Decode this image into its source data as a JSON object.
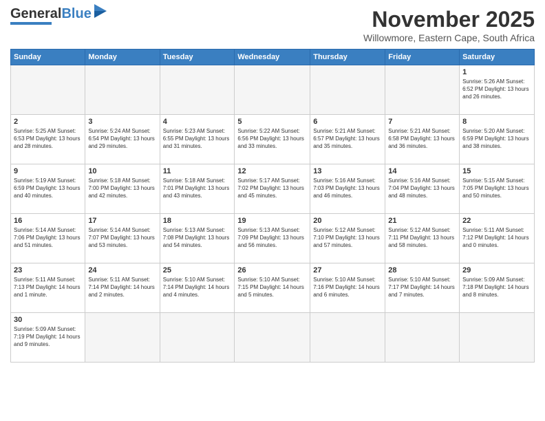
{
  "header": {
    "logo": {
      "text_general": "General",
      "text_blue": "Blue"
    },
    "title": "November 2025",
    "subtitle": "Willowmore, Eastern Cape, South Africa"
  },
  "days_of_week": [
    "Sunday",
    "Monday",
    "Tuesday",
    "Wednesday",
    "Thursday",
    "Friday",
    "Saturday"
  ],
  "weeks": [
    [
      {
        "day": "",
        "info": ""
      },
      {
        "day": "",
        "info": ""
      },
      {
        "day": "",
        "info": ""
      },
      {
        "day": "",
        "info": ""
      },
      {
        "day": "",
        "info": ""
      },
      {
        "day": "",
        "info": ""
      },
      {
        "day": "1",
        "info": "Sunrise: 5:26 AM\nSunset: 6:52 PM\nDaylight: 13 hours and 26 minutes."
      }
    ],
    [
      {
        "day": "2",
        "info": "Sunrise: 5:25 AM\nSunset: 6:53 PM\nDaylight: 13 hours and 28 minutes."
      },
      {
        "day": "3",
        "info": "Sunrise: 5:24 AM\nSunset: 6:54 PM\nDaylight: 13 hours and 29 minutes."
      },
      {
        "day": "4",
        "info": "Sunrise: 5:23 AM\nSunset: 6:55 PM\nDaylight: 13 hours and 31 minutes."
      },
      {
        "day": "5",
        "info": "Sunrise: 5:22 AM\nSunset: 6:56 PM\nDaylight: 13 hours and 33 minutes."
      },
      {
        "day": "6",
        "info": "Sunrise: 5:21 AM\nSunset: 6:57 PM\nDaylight: 13 hours and 35 minutes."
      },
      {
        "day": "7",
        "info": "Sunrise: 5:21 AM\nSunset: 6:58 PM\nDaylight: 13 hours and 36 minutes."
      },
      {
        "day": "8",
        "info": "Sunrise: 5:20 AM\nSunset: 6:59 PM\nDaylight: 13 hours and 38 minutes."
      }
    ],
    [
      {
        "day": "9",
        "info": "Sunrise: 5:19 AM\nSunset: 6:59 PM\nDaylight: 13 hours and 40 minutes."
      },
      {
        "day": "10",
        "info": "Sunrise: 5:18 AM\nSunset: 7:00 PM\nDaylight: 13 hours and 42 minutes."
      },
      {
        "day": "11",
        "info": "Sunrise: 5:18 AM\nSunset: 7:01 PM\nDaylight: 13 hours and 43 minutes."
      },
      {
        "day": "12",
        "info": "Sunrise: 5:17 AM\nSunset: 7:02 PM\nDaylight: 13 hours and 45 minutes."
      },
      {
        "day": "13",
        "info": "Sunrise: 5:16 AM\nSunset: 7:03 PM\nDaylight: 13 hours and 46 minutes."
      },
      {
        "day": "14",
        "info": "Sunrise: 5:16 AM\nSunset: 7:04 PM\nDaylight: 13 hours and 48 minutes."
      },
      {
        "day": "15",
        "info": "Sunrise: 5:15 AM\nSunset: 7:05 PM\nDaylight: 13 hours and 50 minutes."
      }
    ],
    [
      {
        "day": "16",
        "info": "Sunrise: 5:14 AM\nSunset: 7:06 PM\nDaylight: 13 hours and 51 minutes."
      },
      {
        "day": "17",
        "info": "Sunrise: 5:14 AM\nSunset: 7:07 PM\nDaylight: 13 hours and 53 minutes."
      },
      {
        "day": "18",
        "info": "Sunrise: 5:13 AM\nSunset: 7:08 PM\nDaylight: 13 hours and 54 minutes."
      },
      {
        "day": "19",
        "info": "Sunrise: 5:13 AM\nSunset: 7:09 PM\nDaylight: 13 hours and 56 minutes."
      },
      {
        "day": "20",
        "info": "Sunrise: 5:12 AM\nSunset: 7:10 PM\nDaylight: 13 hours and 57 minutes."
      },
      {
        "day": "21",
        "info": "Sunrise: 5:12 AM\nSunset: 7:11 PM\nDaylight: 13 hours and 58 minutes."
      },
      {
        "day": "22",
        "info": "Sunrise: 5:11 AM\nSunset: 7:12 PM\nDaylight: 14 hours and 0 minutes."
      }
    ],
    [
      {
        "day": "23",
        "info": "Sunrise: 5:11 AM\nSunset: 7:13 PM\nDaylight: 14 hours and 1 minute."
      },
      {
        "day": "24",
        "info": "Sunrise: 5:11 AM\nSunset: 7:14 PM\nDaylight: 14 hours and 2 minutes."
      },
      {
        "day": "25",
        "info": "Sunrise: 5:10 AM\nSunset: 7:14 PM\nDaylight: 14 hours and 4 minutes."
      },
      {
        "day": "26",
        "info": "Sunrise: 5:10 AM\nSunset: 7:15 PM\nDaylight: 14 hours and 5 minutes."
      },
      {
        "day": "27",
        "info": "Sunrise: 5:10 AM\nSunset: 7:16 PM\nDaylight: 14 hours and 6 minutes."
      },
      {
        "day": "28",
        "info": "Sunrise: 5:10 AM\nSunset: 7:17 PM\nDaylight: 14 hours and 7 minutes."
      },
      {
        "day": "29",
        "info": "Sunrise: 5:09 AM\nSunset: 7:18 PM\nDaylight: 14 hours and 8 minutes."
      }
    ],
    [
      {
        "day": "30",
        "info": "Sunrise: 5:09 AM\nSunset: 7:19 PM\nDaylight: 14 hours and 9 minutes."
      },
      {
        "day": "",
        "info": ""
      },
      {
        "day": "",
        "info": ""
      },
      {
        "day": "",
        "info": ""
      },
      {
        "day": "",
        "info": ""
      },
      {
        "day": "",
        "info": ""
      },
      {
        "day": "",
        "info": ""
      }
    ]
  ]
}
